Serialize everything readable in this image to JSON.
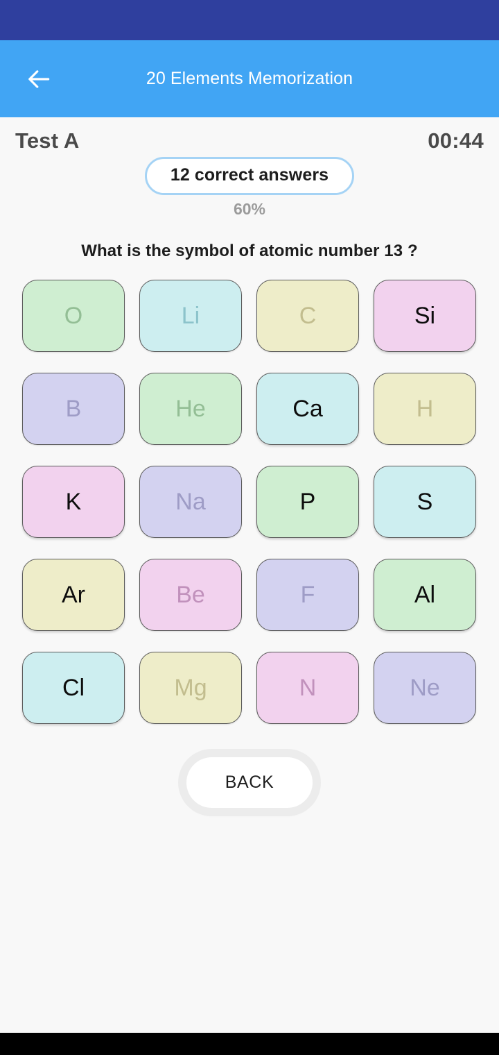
{
  "status_bar": {
    "color": "#2f3f9e"
  },
  "app_bar": {
    "color": "#41a5f4",
    "title": "20 Elements Memorization",
    "back_icon": "arrow-left-icon"
  },
  "header": {
    "test_name": "Test A",
    "timer": "00:44"
  },
  "score": {
    "badge_label": "12 correct answers",
    "percent": "60%",
    "badge_border_color": "#a5d3f5"
  },
  "question": {
    "text": "What is the symbol of atomic number 13  ?"
  },
  "palette": {
    "green_bg": "#cfeed1",
    "green_used_text": "#93be95",
    "cyan_bg": "#cdeef0",
    "cyan_used_text": "#8cc3cb",
    "yellow_bg": "#eeedc9",
    "yellow_used_text": "#c2bd8e",
    "pink_bg": "#f2d2ee",
    "pink_used_text": "#c191bc",
    "purple_bg": "#d3d2f0",
    "purple_used_text": "#9e9cc6",
    "active_text": "#0d0d0d"
  },
  "tiles": [
    {
      "symbol": "O",
      "color": "green",
      "used": true
    },
    {
      "symbol": "Li",
      "color": "cyan",
      "used": true
    },
    {
      "symbol": "C",
      "color": "yellow",
      "used": true
    },
    {
      "symbol": "Si",
      "color": "pink",
      "used": false
    },
    {
      "symbol": "B",
      "color": "purple",
      "used": true
    },
    {
      "symbol": "He",
      "color": "green",
      "used": true
    },
    {
      "symbol": "Ca",
      "color": "cyan",
      "used": false
    },
    {
      "symbol": "H",
      "color": "yellow",
      "used": true
    },
    {
      "symbol": "K",
      "color": "pink",
      "used": false
    },
    {
      "symbol": "Na",
      "color": "purple",
      "used": true
    },
    {
      "symbol": "P",
      "color": "green",
      "used": false
    },
    {
      "symbol": "S",
      "color": "cyan",
      "used": false
    },
    {
      "symbol": "Ar",
      "color": "yellow",
      "used": false
    },
    {
      "symbol": "Be",
      "color": "pink",
      "used": true
    },
    {
      "symbol": "F",
      "color": "purple",
      "used": true
    },
    {
      "symbol": "Al",
      "color": "green",
      "used": false
    },
    {
      "symbol": "Cl",
      "color": "cyan",
      "used": false
    },
    {
      "symbol": "Mg",
      "color": "yellow",
      "used": true
    },
    {
      "symbol": "N",
      "color": "pink",
      "used": true
    },
    {
      "symbol": "Ne",
      "color": "purple",
      "used": true
    }
  ],
  "footer": {
    "back_label": "BACK"
  },
  "nav_bar": {
    "color": "#000000"
  }
}
